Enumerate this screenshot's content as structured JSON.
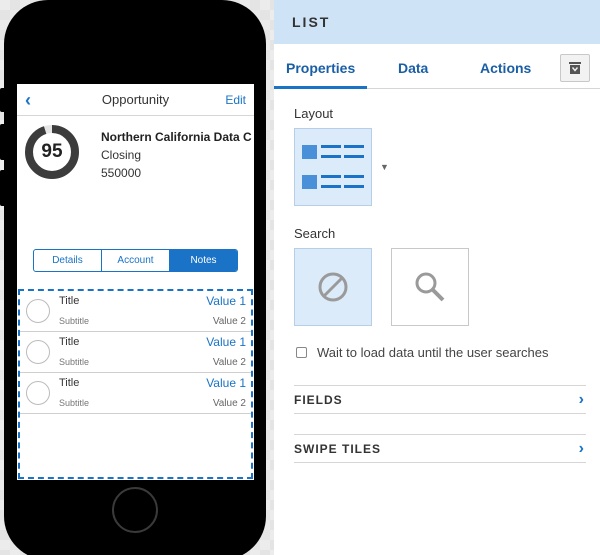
{
  "mobile": {
    "header": {
      "back_icon": "chevron-left-icon",
      "title": "Opportunity",
      "edit_label": "Edit"
    },
    "summary": {
      "score": "95",
      "score_fraction": 0.95,
      "name": "Northern California Data C",
      "stage": "Closing",
      "amount": "550000"
    },
    "segments": [
      {
        "label": "Details",
        "active": false
      },
      {
        "label": "Account",
        "active": false
      },
      {
        "label": "Notes",
        "active": true
      }
    ],
    "list_rows": [
      {
        "title": "Title",
        "subtitle": "Subtitle",
        "value1": "Value 1",
        "value2": "Value 2"
      },
      {
        "title": "Title",
        "subtitle": "Subtitle",
        "value1": "Value 1",
        "value2": "Value 2"
      },
      {
        "title": "Title",
        "subtitle": "Subtitle",
        "value1": "Value 1",
        "value2": "Value 2"
      }
    ]
  },
  "panel": {
    "title": "LIST",
    "tabs": [
      {
        "label": "Properties",
        "active": true
      },
      {
        "label": "Data",
        "active": false
      },
      {
        "label": "Actions",
        "active": false
      }
    ],
    "tab_icon": "component-icon",
    "layout_label": "Layout",
    "layout_icon": "list-layout-icon",
    "search_label": "Search",
    "search_options": [
      {
        "icon": "no-search-icon",
        "selected": true
      },
      {
        "icon": "search-icon",
        "selected": false
      }
    ],
    "checkbox_label": "Wait to load data until the user searches",
    "checkbox_checked": false,
    "sections": [
      {
        "label": "FIELDS"
      },
      {
        "label": "SWIPE TILES"
      }
    ]
  },
  "colors": {
    "accent": "#1a73c6",
    "header_bg": "#cfe3f6",
    "tile_selected": "#dcebfa"
  }
}
